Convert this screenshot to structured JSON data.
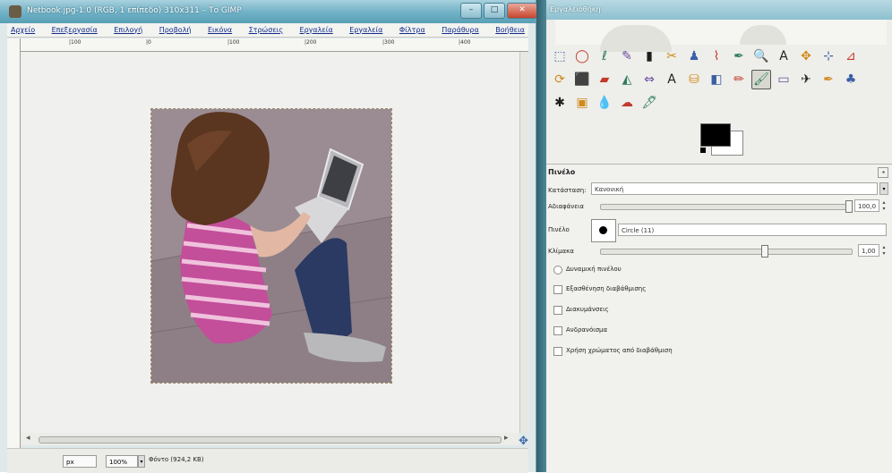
{
  "image_window": {
    "title": "Netbook.jpg-1.0 (RGB, 1 επίπεδο) 310x311 – Το GIMP",
    "menu": [
      "Αρχείο",
      "Επεξεργασία",
      "Επιλογή",
      "Προβολή",
      "Εικόνα",
      "Στρώσεις",
      "Εργαλεία",
      "Εργαλεία",
      "Φίλτρα",
      "Παράθυρα",
      "Βοήθεια"
    ],
    "ruler_labels": [
      "|100",
      "|0",
      "|100",
      "|200",
      "|300",
      "|400"
    ],
    "status": {
      "unit": "px",
      "zoom": "100%",
      "info": "Φόντο (924,2 KB)"
    }
  },
  "toolbox": {
    "title": "Εργαλειοθήκη",
    "tool_rows": [
      [
        "rect-select-icon",
        "ellipse-select-icon",
        "lasso-icon",
        "fuzzy-select-icon",
        "color-select-icon",
        "scissors-icon",
        "foreground-select-icon",
        "paths-icon",
        "color-picker-icon",
        "zoom-icon",
        "measure-icon",
        "move-icon",
        "align-icon",
        "crop-icon"
      ],
      [
        "rotate-icon",
        "scale-icon",
        "shear-icon",
        "perspective-icon",
        "flip-icon",
        "text-icon",
        "bucket-fill-icon",
        "blend-icon",
        "pencil-icon",
        "paintbrush-icon",
        "eraser-icon",
        "airbrush-icon",
        "ink-icon",
        "clone-icon"
      ],
      [
        "heal-icon",
        "perspective-clone-icon",
        "blur-icon",
        "smudge-icon",
        "dodge-burn-icon"
      ]
    ],
    "tool_glyphs": [
      [
        "⬚",
        "◯",
        "ℓ",
        "✎",
        "▮",
        "✂",
        "♟",
        "⌇",
        "✒",
        "🔍",
        "A",
        "✥",
        "⊹",
        "⊿"
      ],
      [
        "⟳",
        "⬛",
        "▰",
        "◭",
        "⇔",
        "A",
        "⛁",
        "◧",
        "✏",
        "🖌",
        "▭",
        "✈",
        "✒",
        "♣"
      ],
      [
        "✱",
        "▣",
        "💧",
        "☁",
        "🖋"
      ]
    ],
    "colors": {
      "foreground": "#000000",
      "background": "#ffffff"
    },
    "options": {
      "title": "Πινέλο",
      "mode_label": "Κατάσταση:",
      "mode_value": "Κανονική",
      "opacity_label": "Αδιαφάνεια",
      "opacity_value": "100,0",
      "brush_label": "Πινέλο",
      "brush_value": "Circle (11)",
      "scale_label": "Κλίμακα",
      "scale_value": "1,00",
      "checkboxes": [
        "Δυναμική πινέλου",
        "Εξασθένηση διαβάθμισης",
        "Διακυμάνσεις",
        "Ανδρανόισμα",
        "Χρήση χρώματος από διαβάθμιση"
      ]
    }
  },
  "colors": {
    "title_gradient_top": "#a8d1de",
    "close_button": "#c6452d",
    "menu_text": "#102c8c"
  }
}
